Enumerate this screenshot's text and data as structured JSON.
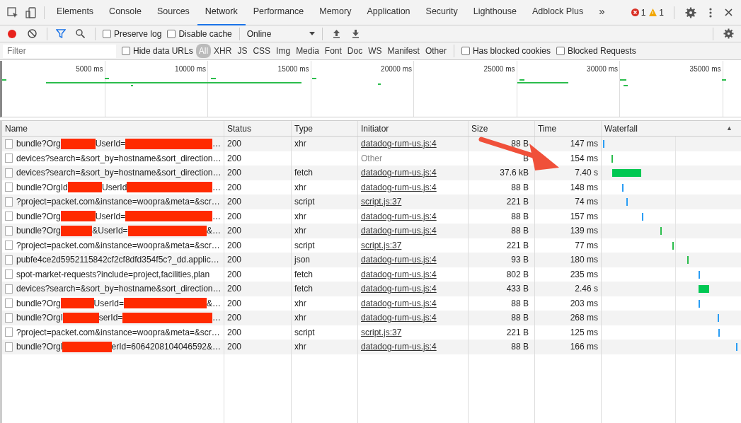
{
  "tabs": [
    {
      "label": "Elements",
      "selected": false
    },
    {
      "label": "Console",
      "selected": false
    },
    {
      "label": "Sources",
      "selected": false
    },
    {
      "label": "Network",
      "selected": true
    },
    {
      "label": "Performance",
      "selected": false
    },
    {
      "label": "Memory",
      "selected": false
    },
    {
      "label": "Application",
      "selected": false
    },
    {
      "label": "Security",
      "selected": false
    },
    {
      "label": "Lighthouse",
      "selected": false
    },
    {
      "label": "Adblock Plus",
      "selected": false
    }
  ],
  "more_tabs": "»",
  "errors": "1",
  "warnings": "1",
  "toolbar": {
    "recording": true,
    "filter_on": true,
    "preserve_log": {
      "label": "Preserve log",
      "checked": false
    },
    "disable_cache": {
      "label": "Disable cache",
      "checked": false
    },
    "throttling": "Online"
  },
  "filter_bar": {
    "placeholder": "Filter",
    "hide_data_urls": {
      "label": "Hide data URLs",
      "checked": false
    },
    "types": [
      {
        "label": "All",
        "selected": true
      },
      {
        "label": "XHR",
        "selected": false
      },
      {
        "label": "JS",
        "selected": false
      },
      {
        "label": "CSS",
        "selected": false
      },
      {
        "label": "Img",
        "selected": false
      },
      {
        "label": "Media",
        "selected": false
      },
      {
        "label": "Font",
        "selected": false
      },
      {
        "label": "Doc",
        "selected": false
      },
      {
        "label": "WS",
        "selected": false
      },
      {
        "label": "Manifest",
        "selected": false
      },
      {
        "label": "Other",
        "selected": false
      }
    ],
    "blocked_cookies": {
      "label": "Has blocked cookies",
      "checked": false
    },
    "blocked_requests": {
      "label": "Blocked Requests",
      "checked": false
    }
  },
  "overview_ticks": [
    "5000 ms",
    "10000 ms",
    "15000 ms",
    "20000 ms",
    "25000 ms",
    "30000 ms",
    "35000 ms"
  ],
  "table": {
    "columns": [
      "Name",
      "Status",
      "Type",
      "Initiator",
      "Size",
      "Time",
      "Waterfall"
    ],
    "sort_icon": "▲",
    "rows": [
      {
        "name_parts": [
          "bundle?Org",
          "UserId=",
          "…"
        ],
        "status": "200",
        "type": "xhr",
        "initiator": {
          "text": "datadog-rum-us.js:4",
          "kind": "link"
        },
        "size": "88 B",
        "time": "147 ms"
      },
      {
        "name_parts": [
          "devices?search=&sort_by=hostname&sort_direction…"
        ],
        "status": "200",
        "initiator": {
          "text": "Other",
          "kind": "plain"
        },
        "size": "B",
        "time": "154 ms"
      },
      {
        "name_parts": [
          "devices?search=&sort_by=hostname&sort_direction…"
        ],
        "status": "200",
        "type": "fetch",
        "initiator": {
          "text": "datadog-rum-us.js:4",
          "kind": "link"
        },
        "size": "37.6 kB",
        "time": "7.40 s"
      },
      {
        "name_parts": [
          "bundle?OrgId",
          "UserId",
          "…"
        ],
        "status": "200",
        "type": "xhr",
        "initiator": {
          "text": "datadog-rum-us.js:4",
          "kind": "link"
        },
        "size": "88 B",
        "time": "148 ms"
      },
      {
        "name_parts": [
          "?project=packet.com&instance=woopra&meta=&scr…"
        ],
        "status": "200",
        "type": "script",
        "initiator": {
          "text": "script.js:37",
          "kind": "link"
        },
        "size": "221 B",
        "time": "74 ms"
      },
      {
        "name_parts": [
          "bundle?Org",
          "UserId=",
          "…"
        ],
        "status": "200",
        "type": "xhr",
        "initiator": {
          "text": "datadog-rum-us.js:4",
          "kind": "link"
        },
        "size": "88 B",
        "time": "157 ms"
      },
      {
        "name_parts": [
          "bundle?Org",
          "&UserId=",
          "&…"
        ],
        "status": "200",
        "type": "xhr",
        "initiator": {
          "text": "datadog-rum-us.js:4",
          "kind": "link"
        },
        "size": "88 B",
        "time": "139 ms"
      },
      {
        "name_parts": [
          "?project=packet.com&instance=woopra&meta=&scr…"
        ],
        "status": "200",
        "type": "script",
        "initiator": {
          "text": "script.js:37",
          "kind": "link"
        },
        "size": "221 B",
        "time": "77 ms"
      },
      {
        "name_parts": [
          "pubfe4ce2d5952115842cf2cf8dfd354f5c?_dd.applic…"
        ],
        "status": "200",
        "type": "json",
        "initiator": {
          "text": "datadog-rum-us.js:4",
          "kind": "link"
        },
        "size": "93 B",
        "time": "180 ms"
      },
      {
        "name_parts": [
          "spot-market-requests?include=project,facilities,plan"
        ],
        "status": "200",
        "type": "fetch",
        "initiator": {
          "text": "datadog-rum-us.js:4",
          "kind": "link"
        },
        "size": "802 B",
        "time": "235 ms"
      },
      {
        "name_parts": [
          "devices?search=&sort_by=hostname&sort_direction…"
        ],
        "status": "200",
        "type": "fetch",
        "initiator": {
          "text": "datadog-rum-us.js:4",
          "kind": "link"
        },
        "size": "433 B",
        "time": "2.46 s"
      },
      {
        "name_parts": [
          "bundle?Org",
          "UserId=",
          "&…"
        ],
        "status": "200",
        "type": "xhr",
        "initiator": {
          "text": "datadog-rum-us.js:4",
          "kind": "link"
        },
        "size": "88 B",
        "time": "203 ms"
      },
      {
        "name_parts": [
          "bundle?OrgI",
          "serId=",
          "…"
        ],
        "status": "200",
        "type": "xhr",
        "initiator": {
          "text": "datadog-rum-us.js:4",
          "kind": "link"
        },
        "size": "88 B",
        "time": "268 ms"
      },
      {
        "name_parts": [
          "?project=packet.com&instance=woopra&meta=&scr…"
        ],
        "status": "200",
        "type": "script",
        "initiator": {
          "text": "script.js:37",
          "kind": "link"
        },
        "size": "221 B",
        "time": "125 ms"
      },
      {
        "name_parts": [
          "bundle?Orgl",
          "erId=6064208104046592&…"
        ],
        "status": "200",
        "type": "xhr",
        "initiator": {
          "text": "datadog-rum-us.js:4",
          "kind": "link"
        },
        "size": "88 B",
        "time": "166 ms"
      }
    ]
  }
}
